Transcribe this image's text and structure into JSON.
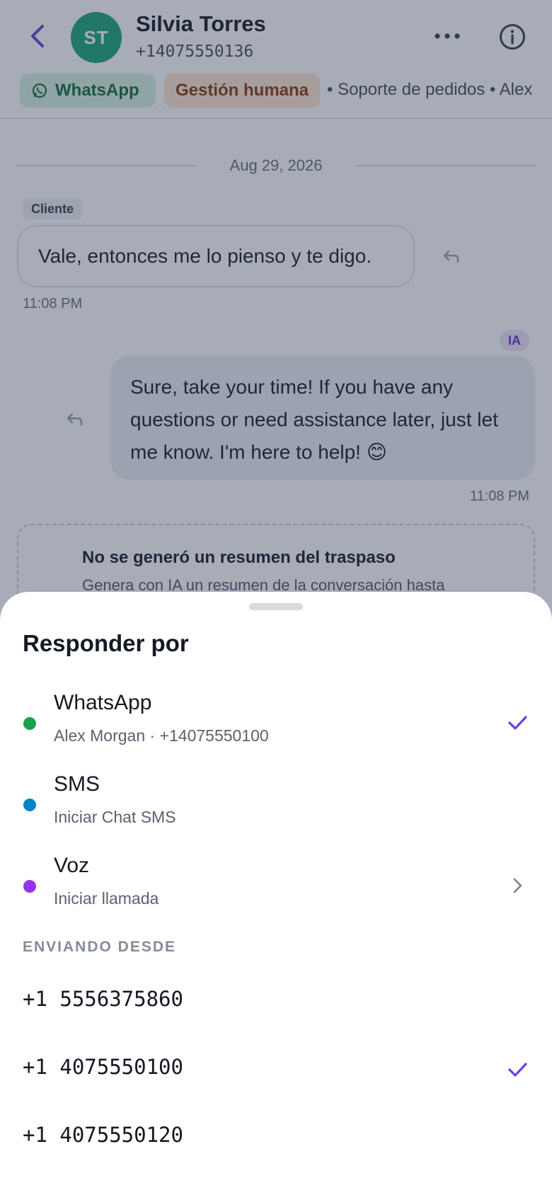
{
  "header": {
    "avatar_initials": "ST",
    "contact_name": "Silvia Torres",
    "contact_phone": "+14075550136",
    "channel_tag": "WhatsApp",
    "status_tag": "Gestión humana",
    "meta_text": "• Soporte de pedidos  • Alex"
  },
  "chat": {
    "date_divider": "Aug 29, 2026",
    "incoming": {
      "sender": "Cliente",
      "text": "Vale, entonces me lo pienso y te digo.",
      "time": "11:08 PM"
    },
    "outgoing": {
      "badge": "IA",
      "text": "Sure, take your time! If you have any questions or need assistance later, just let me know. I'm here to help! 😊",
      "time": "11:08 PM"
    },
    "handoff": {
      "title": "No se generó un resumen del traspaso",
      "description": "Genera con IA un resumen de la conversación hasta"
    }
  },
  "sheet": {
    "title": "Responder por",
    "options": [
      {
        "name": "WhatsApp",
        "subtitle": "Alex Morgan · +14075550100",
        "color": "#16a34a",
        "state": "selected"
      },
      {
        "name": "SMS",
        "subtitle": "Iniciar Chat SMS",
        "color": "#0284c7",
        "state": "none"
      },
      {
        "name": "Voz",
        "subtitle": "Iniciar llamada",
        "color": "#9333ea",
        "state": "chevron"
      }
    ],
    "sending_from_label": "ENVIANDO DESDE",
    "numbers": [
      {
        "number": "+1 5556375860",
        "selected": false
      },
      {
        "number": "+1 4075550100",
        "selected": true
      },
      {
        "number": "+1 4075550120",
        "selected": false
      }
    ]
  },
  "colors": {
    "accent": "#6d3fe0",
    "avatar": "#1fa97a",
    "scrim": "rgba(38,48,76,0.40)"
  }
}
